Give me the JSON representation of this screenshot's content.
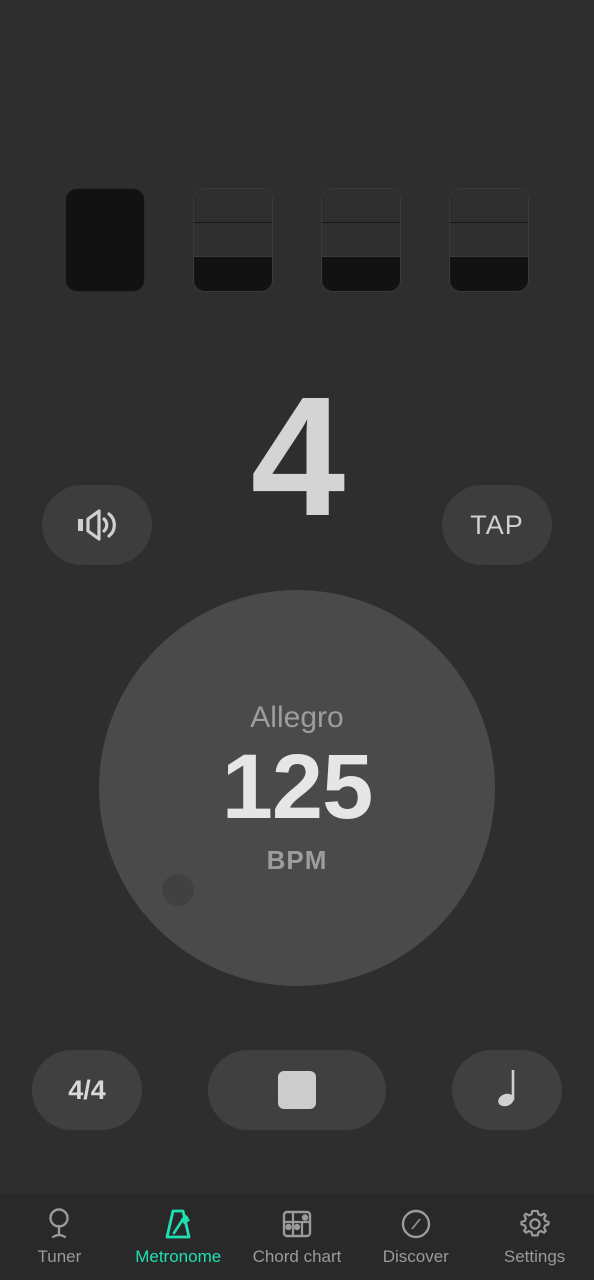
{
  "theme": {
    "background": "#2e2e2e",
    "accent": "#1ee0b4",
    "dial_bg": "#4a4a4a",
    "button_bg": "#3d3d3d",
    "text_primary": "#e6e6e6",
    "text_secondary": "#9a9a9a",
    "beat_fill": "#121212"
  },
  "beats": {
    "count": 4,
    "current_beat": "4",
    "indicators": [
      {
        "index": 1,
        "state": "active",
        "name": "beat-indicator-1"
      },
      {
        "index": 2,
        "state": "inactive",
        "name": "beat-indicator-2"
      },
      {
        "index": 3,
        "state": "inactive",
        "name": "beat-indicator-3"
      },
      {
        "index": 4,
        "state": "inactive",
        "name": "beat-indicator-4"
      }
    ]
  },
  "sound_button": {
    "icon": "speaker-icon",
    "state": "on"
  },
  "tap_button": {
    "label": "TAP"
  },
  "tempo": {
    "name": "Allegro",
    "bpm": "125",
    "unit": "BPM"
  },
  "controls": {
    "time_signature": "4/4",
    "transport": {
      "icon": "stop-icon",
      "state": "playing"
    },
    "subdivision": {
      "icon": "quarter-note-icon",
      "label": "quarter note"
    }
  },
  "navigation": {
    "active": "Metronome",
    "items": [
      {
        "label": "Tuner",
        "icon": "tuning-fork-icon"
      },
      {
        "label": "Metronome",
        "icon": "metronome-icon"
      },
      {
        "label": "Chord chart",
        "icon": "chord-chart-icon"
      },
      {
        "label": "Discover",
        "icon": "compass-icon"
      },
      {
        "label": "Settings",
        "icon": "gear-icon"
      }
    ]
  }
}
